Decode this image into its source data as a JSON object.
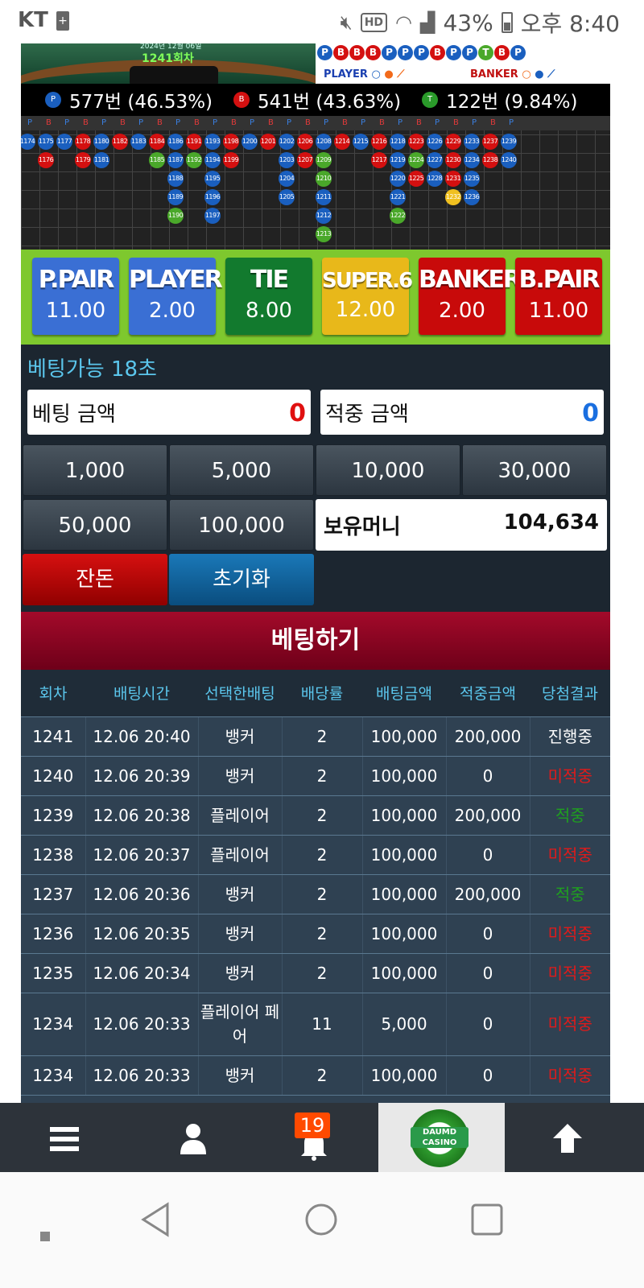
{
  "status_bar": {
    "carrier": "KT",
    "battery_pct": "43%",
    "time": "오후 8:40"
  },
  "game": {
    "round_label": "1241회차",
    "date_small": "2024년 12월 06일",
    "bead_top": [
      "P",
      "B",
      "B",
      "B",
      "P",
      "P",
      "P",
      "B",
      "P",
      "P",
      "T",
      "B",
      "P"
    ],
    "legend_player": "PLAYER",
    "legend_banker": "BANKER",
    "counts": [
      {
        "badge": "P",
        "text": "577번 (46.53%)",
        "color": "#1a5fbf"
      },
      {
        "badge": "B",
        "text": "541번 (43.63%)",
        "color": "#d41010"
      },
      {
        "badge": "T",
        "text": "122번 (9.84%)",
        "color": "#2a9a2a"
      }
    ],
    "road_header": [
      "P",
      "B",
      "P",
      "B",
      "P",
      "B",
      "P",
      "B",
      "P",
      "B",
      "P",
      "B",
      "P",
      "B",
      "P",
      "B",
      "P",
      "B",
      "P",
      "B",
      "P",
      "B",
      "P",
      "B",
      "P",
      "B",
      "P"
    ],
    "road_columns": [
      [
        {
          "n": "1174",
          "c": "P"
        }
      ],
      [
        {
          "n": "1175",
          "c": "P"
        },
        {
          "n": "1176",
          "c": "B"
        }
      ],
      [
        {
          "n": "1177",
          "c": "P"
        }
      ],
      [
        {
          "n": "1178",
          "c": "B"
        },
        {
          "n": "1179",
          "c": "B"
        }
      ],
      [
        {
          "n": "1180",
          "c": "P"
        },
        {
          "n": "1181",
          "c": "P"
        }
      ],
      [
        {
          "n": "1182",
          "c": "B"
        }
      ],
      [
        {
          "n": "1183",
          "c": "P"
        }
      ],
      [
        {
          "n": "1184",
          "c": "B"
        },
        {
          "n": "1185",
          "c": "T"
        }
      ],
      [
        {
          "n": "1186",
          "c": "P"
        },
        {
          "n": "1187",
          "c": "P"
        },
        {
          "n": "1188",
          "c": "P"
        },
        {
          "n": "1189",
          "c": "P"
        },
        {
          "n": "1190",
          "c": "T"
        }
      ],
      [
        {
          "n": "1191",
          "c": "B"
        },
        {
          "n": "1192",
          "c": "T"
        }
      ],
      [
        {
          "n": "1193",
          "c": "P"
        },
        {
          "n": "1194",
          "c": "P"
        },
        {
          "n": "1195",
          "c": "P"
        },
        {
          "n": "1196",
          "c": "P"
        },
        {
          "n": "1197",
          "c": "P"
        }
      ],
      [
        {
          "n": "1198",
          "c": "B"
        },
        {
          "n": "1199",
          "c": "B"
        }
      ],
      [
        {
          "n": "1200",
          "c": "P"
        }
      ],
      [
        {
          "n": "1201",
          "c": "B"
        }
      ],
      [
        {
          "n": "1202",
          "c": "P"
        },
        {
          "n": "1203",
          "c": "P"
        },
        {
          "n": "1204",
          "c": "P"
        },
        {
          "n": "1205",
          "c": "P"
        }
      ],
      [
        {
          "n": "1206",
          "c": "B"
        },
        {
          "n": "1207",
          "c": "B"
        }
      ],
      [
        {
          "n": "1208",
          "c": "P"
        },
        {
          "n": "1209",
          "c": "T"
        },
        {
          "n": "1210",
          "c": "T"
        },
        {
          "n": "1211",
          "c": "P"
        },
        {
          "n": "1212",
          "c": "P"
        },
        {
          "n": "1213",
          "c": "T"
        }
      ],
      [
        {
          "n": "1214",
          "c": "B"
        }
      ],
      [
        {
          "n": "1215",
          "c": "P"
        }
      ],
      [
        {
          "n": "1216",
          "c": "B"
        },
        {
          "n": "1217",
          "c": "B"
        }
      ],
      [
        {
          "n": "1218",
          "c": "P"
        },
        {
          "n": "1219",
          "c": "P"
        },
        {
          "n": "1220",
          "c": "P"
        },
        {
          "n": "1221",
          "c": "P"
        },
        {
          "n": "1222",
          "c": "T"
        }
      ],
      [
        {
          "n": "1223",
          "c": "B"
        },
        {
          "n": "1224",
          "c": "T"
        },
        {
          "n": "1225",
          "c": "B"
        }
      ],
      [
        {
          "n": "1226",
          "c": "P"
        },
        {
          "n": "1227",
          "c": "P"
        },
        {
          "n": "1228",
          "c": "P"
        }
      ],
      [
        {
          "n": "1229",
          "c": "B"
        },
        {
          "n": "1230",
          "c": "B"
        },
        {
          "n": "1231",
          "c": "B"
        },
        {
          "n": "1232",
          "c": "Y"
        }
      ],
      [
        {
          "n": "1233",
          "c": "P"
        },
        {
          "n": "1234",
          "c": "P"
        },
        {
          "n": "1235",
          "c": "P"
        },
        {
          "n": "1236",
          "c": "P"
        }
      ],
      [
        {
          "n": "1237",
          "c": "B"
        },
        {
          "n": "1238",
          "c": "B"
        }
      ],
      [
        {
          "n": "1239",
          "c": "P"
        },
        {
          "n": "1240",
          "c": "P"
        }
      ]
    ]
  },
  "bets": [
    {
      "label": "P.PAIR",
      "odds": "11.00",
      "bg": "#3a6fd4"
    },
    {
      "label": "PLAYER",
      "odds": "2.00",
      "bg": "#3a6fd4"
    },
    {
      "label": "TIE",
      "odds": "8.00",
      "bg": "#127a2e"
    },
    {
      "label": "SUPER.6",
      "odds": "12.00",
      "bg": "#e8b81a"
    },
    {
      "label": "BANKER",
      "odds": "2.00",
      "bg": "#c80a0a"
    },
    {
      "label": "B.PAIR",
      "odds": "11.00",
      "bg": "#c80a0a"
    }
  ],
  "panel": {
    "timer": "베팅가능 18초",
    "bet_amount_label": "베팅 금액",
    "bet_amount_value": "0",
    "win_amount_label": "적중 금액",
    "win_amount_value": "0",
    "chips": [
      "1,000",
      "5,000",
      "10,000",
      "30,000",
      "50,000",
      "100,000"
    ],
    "wallet_label": "보유머니",
    "wallet_value": "104,634",
    "change_label": "잔돈",
    "reset_label": "초기화",
    "place_bet_label": "베팅하기"
  },
  "history": {
    "headers": [
      "회차",
      "배팅시간",
      "선택한배팅",
      "배당률",
      "배팅금액",
      "적중금액",
      "당첨결과"
    ],
    "rows": [
      [
        "1241",
        "12.06 20:40",
        "뱅커",
        "2",
        "100,000",
        "200,000",
        "진행중"
      ],
      [
        "1240",
        "12.06 20:39",
        "뱅커",
        "2",
        "100,000",
        "0",
        "미적중"
      ],
      [
        "1239",
        "12.06 20:38",
        "플레이어",
        "2",
        "100,000",
        "200,000",
        "적중"
      ],
      [
        "1238",
        "12.06 20:37",
        "플레이어",
        "2",
        "100,000",
        "0",
        "미적중"
      ],
      [
        "1237",
        "12.06 20:36",
        "뱅커",
        "2",
        "100,000",
        "200,000",
        "적중"
      ],
      [
        "1236",
        "12.06 20:35",
        "뱅커",
        "2",
        "100,000",
        "0",
        "미적중"
      ],
      [
        "1235",
        "12.06 20:34",
        "뱅커",
        "2",
        "100,000",
        "0",
        "미적중"
      ],
      [
        "1234",
        "12.06 20:33",
        "플레이어 페어",
        "11",
        "5,000",
        "0",
        "미적중"
      ],
      [
        "1234",
        "12.06 20:33",
        "뱅커",
        "2",
        "100,000",
        "0",
        "미적중"
      ]
    ],
    "result_colors": {
      "진행중": "#ffffff",
      "미적중": "#e01a1a",
      "적중": "#1fa01f"
    }
  },
  "bottom_nav": {
    "notification_count": "19",
    "logo_text": "DAUMD CASINO"
  }
}
